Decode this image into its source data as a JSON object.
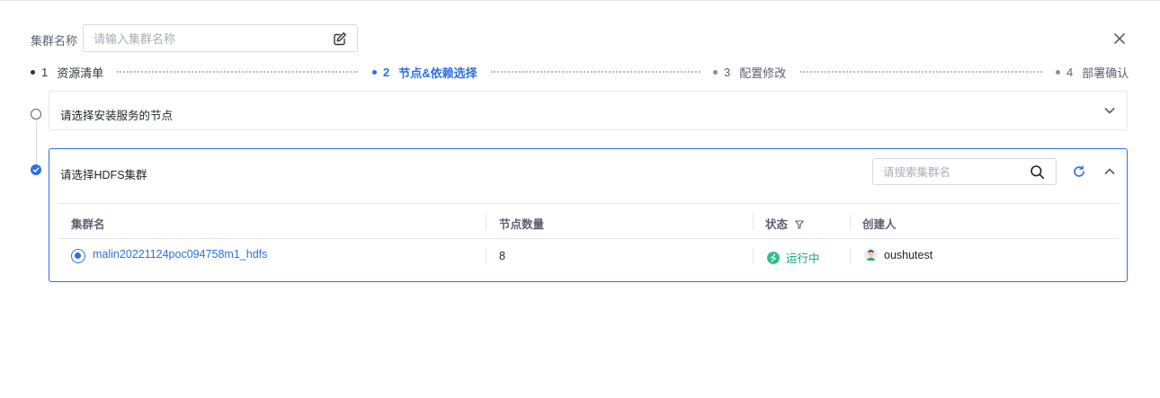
{
  "form": {
    "cluster_name_label": "集群名称",
    "cluster_name_placeholder": "请输入集群名称",
    "cluster_name_value": ""
  },
  "steps": [
    {
      "num": "1",
      "label": "资源清单",
      "state": "done"
    },
    {
      "num": "2",
      "label": "节点&依赖选择",
      "state": "active"
    },
    {
      "num": "3",
      "label": "配置修改",
      "state": "pending"
    },
    {
      "num": "4",
      "label": "部署确认",
      "state": "pending"
    }
  ],
  "panels": {
    "node_select": {
      "title": "请选择安装服务的节点",
      "expanded": false
    },
    "hdfs_select": {
      "title": "请选择HDFS集群",
      "search_placeholder": "请搜索集群名",
      "expanded": true,
      "columns": [
        "集群名",
        "节点数量",
        "状态",
        "创建人"
      ],
      "rows": [
        {
          "name": "malin20221124poc094758m1_hdfs",
          "nodes": "8",
          "status": "运行中",
          "creator": "oushutest",
          "selected": true
        }
      ]
    }
  },
  "colors": {
    "primary": "#2f6fe4",
    "running": "#1aa06d",
    "border": "#e4e7ec"
  },
  "icons": {
    "edit": "edit-icon",
    "close": "close-icon",
    "search": "search-icon",
    "refresh": "refresh-icon",
    "chevron_down": "chevron-down-icon",
    "chevron_up": "chevron-up-icon",
    "filter": "filter-icon",
    "check": "check-circle-icon"
  }
}
